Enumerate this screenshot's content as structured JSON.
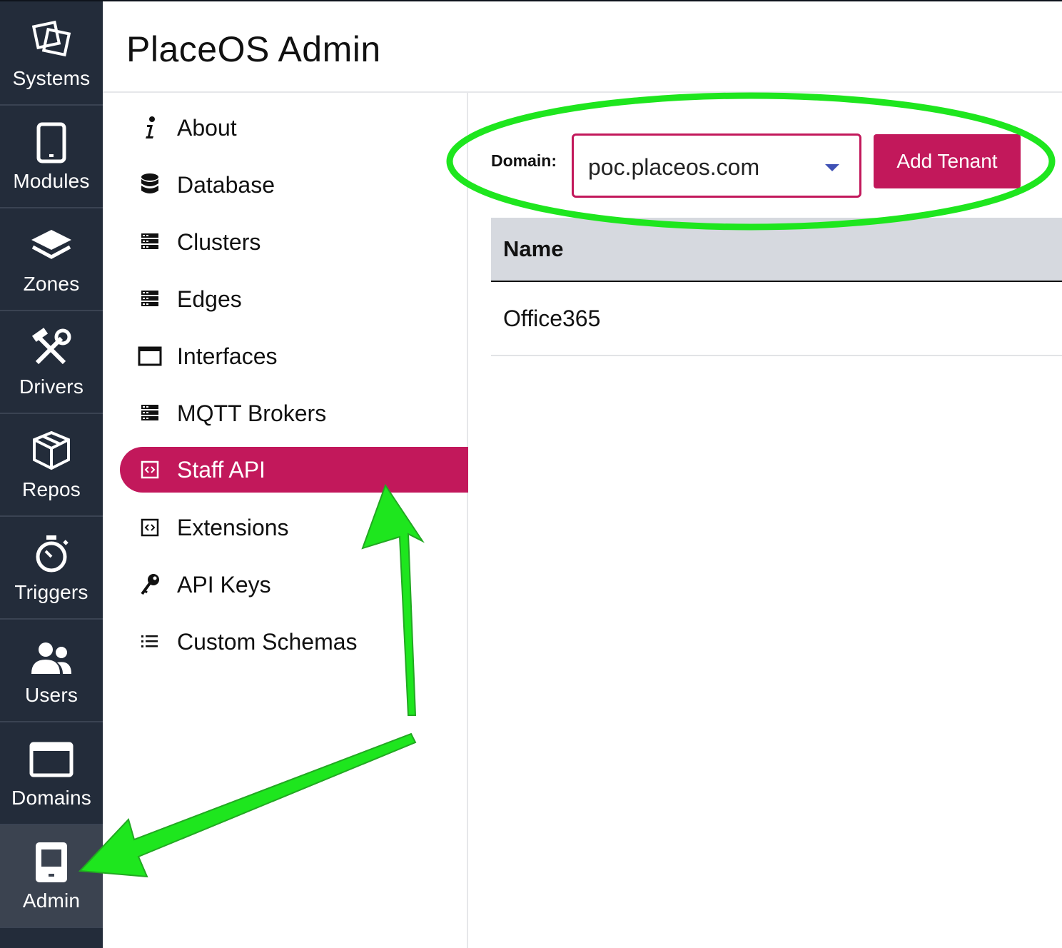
{
  "app": {
    "title": "PlaceOS Admin"
  },
  "rail": {
    "items": [
      {
        "label": "Systems",
        "icon": "systems-icon"
      },
      {
        "label": "Modules",
        "icon": "tablet-icon"
      },
      {
        "label": "Zones",
        "icon": "layers-icon"
      },
      {
        "label": "Drivers",
        "icon": "tools-icon"
      },
      {
        "label": "Repos",
        "icon": "package-icon"
      },
      {
        "label": "Triggers",
        "icon": "stopwatch-icon"
      },
      {
        "label": "Users",
        "icon": "users-icon"
      },
      {
        "label": "Domains",
        "icon": "browser-window-icon"
      },
      {
        "label": "Admin",
        "icon": "admin-icon"
      }
    ],
    "active": "Admin"
  },
  "subnav": {
    "items": [
      {
        "label": "About",
        "icon": "info-icon"
      },
      {
        "label": "Database",
        "icon": "database-icon"
      },
      {
        "label": "Clusters",
        "icon": "server-icon"
      },
      {
        "label": "Edges",
        "icon": "server-icon"
      },
      {
        "label": "Interfaces",
        "icon": "window-icon"
      },
      {
        "label": "MQTT Brokers",
        "icon": "server-icon"
      },
      {
        "label": "Staff API",
        "icon": "code-icon"
      },
      {
        "label": "Extensions",
        "icon": "code-icon"
      },
      {
        "label": "API Keys",
        "icon": "key-icon"
      },
      {
        "label": "Custom Schemas",
        "icon": "list-icon"
      }
    ],
    "active": "Staff API"
  },
  "main": {
    "domain_label": "Domain:",
    "domain_value": "poc.placeos.com",
    "add_button": "Add Tenant",
    "table": {
      "columns": [
        "Name"
      ],
      "rows": [
        [
          "Office365"
        ]
      ]
    }
  },
  "colors": {
    "accent": "#c2185b",
    "rail_bg": "#232c3a",
    "annotation": "#1ee61e"
  }
}
